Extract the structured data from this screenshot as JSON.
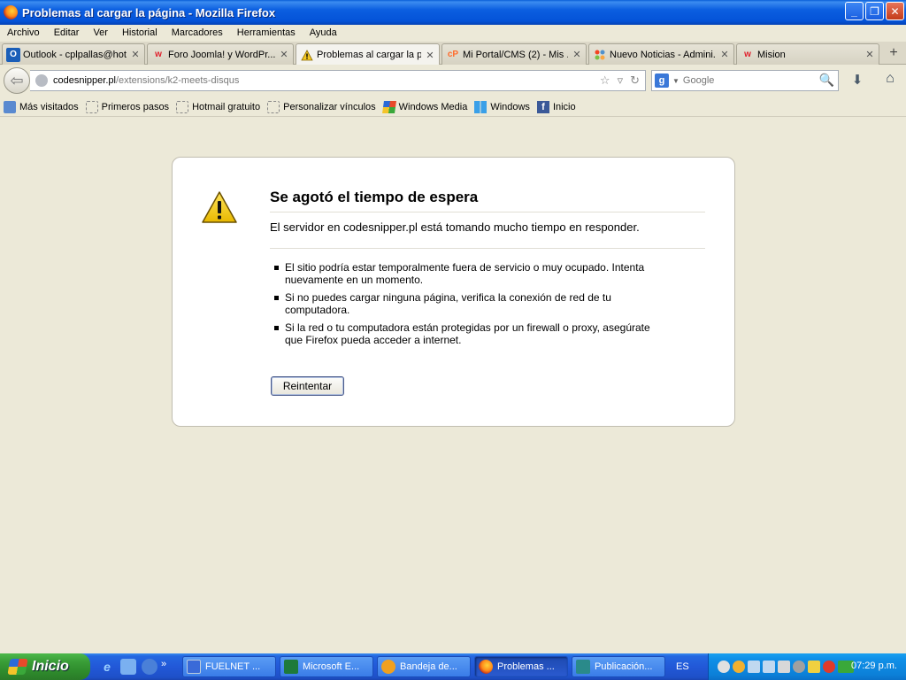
{
  "window": {
    "title": "Problemas al cargar la página - Mozilla Firefox"
  },
  "menu": [
    "Archivo",
    "Editar",
    "Ver",
    "Historial",
    "Marcadores",
    "Herramientas",
    "Ayuda"
  ],
  "tabs": [
    {
      "label": "Outlook - cplpallas@hot...",
      "icon": "outlook-icon",
      "icon_color": "#1a5eb8",
      "icon_text": "O"
    },
    {
      "label": "Foro Joomla! y WordPr...",
      "icon": "wm-icon",
      "icon_color": "#e01e2a",
      "icon_text": "w"
    },
    {
      "label": "Problemas al cargar la p...",
      "icon": "warning-icon",
      "icon_color": "#f0c020",
      "icon_text": "!"
    },
    {
      "label": "Mi Portal/CMS (2) - Mis ...",
      "icon": "cpanel-icon",
      "icon_color": "#ff6c2c",
      "icon_text": "cP"
    },
    {
      "label": "Nuevo Noticias - Admini...",
      "icon": "joomla-icon",
      "icon_color": "#5091cd",
      "icon_text": "J"
    },
    {
      "label": "Mision",
      "icon": "wm-icon",
      "icon_color": "#e01e2a",
      "icon_text": "w"
    }
  ],
  "urlbar": {
    "host": "codesnipper.pl",
    "path": "/extensions/k2-meets-disqus"
  },
  "search": {
    "engine": "Google",
    "placeholder": "Google",
    "engine_letter": "g"
  },
  "bookmarks": [
    {
      "label": "Más visitados",
      "icon": "most-visited-icon"
    },
    {
      "label": "Primeros pasos",
      "icon": "page-icon"
    },
    {
      "label": "Hotmail gratuito",
      "icon": "page-icon"
    },
    {
      "label": "Personalizar vínculos",
      "icon": "page-icon"
    },
    {
      "label": "Windows Media",
      "icon": "windows-flag-icon"
    },
    {
      "label": "Windows",
      "icon": "windows-icon"
    },
    {
      "label": "Inicio",
      "icon": "facebook-icon"
    }
  ],
  "error": {
    "title": "Se agotó el tiempo de espera",
    "description": "El servidor en codesnipper.pl está tomando mucho tiempo en responder.",
    "items": [
      "El sitio podría estar temporalmente fuera de servicio o muy ocupado. Intenta nuevamente en un momento.",
      "Si no puedes cargar ninguna página, verifica la conexión de red de tu computadora.",
      "Si la red o tu computadora están protegidas por un firewall o proxy, asegúrate que Firefox pueda acceder a internet."
    ],
    "button": "Reintentar"
  },
  "taskbar": {
    "start": "Inicio",
    "tasks": [
      {
        "label": "FUELNET ...",
        "icon": "fuelnet-icon",
        "color": "#3a6ad8"
      },
      {
        "label": "Microsoft E...",
        "icon": "excel-icon",
        "color": "#1e7a3a"
      },
      {
        "label": "Bandeja de...",
        "icon": "outlook-icon",
        "color": "#f0a020"
      },
      {
        "label": "Problemas ...",
        "icon": "firefox-icon",
        "color": "#e8761a"
      },
      {
        "label": "Publicación...",
        "icon": "publisher-icon",
        "color": "#2a8a8a"
      }
    ],
    "language": "ES",
    "clock": "07:29 p.m."
  }
}
